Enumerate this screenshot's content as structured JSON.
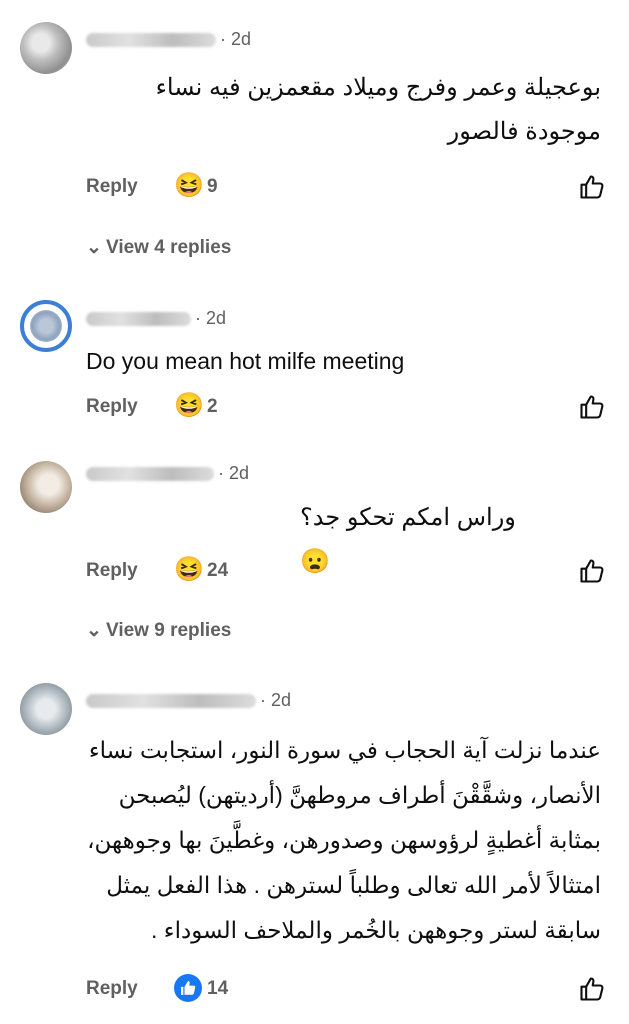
{
  "comments": [
    {
      "time": "· 2d",
      "text": "بوعجيلة وعمر وفرج وميلاد مقعمزين فيه نساء موجودة فالصور",
      "reply_label": "Reply",
      "reaction": "😆",
      "reaction_count": "9",
      "view_replies": "View 4 replies"
    },
    {
      "time": "· 2d",
      "text": "Do you mean hot milfe meeting",
      "reply_label": "Reply",
      "reaction": "😆",
      "reaction_count": "2"
    },
    {
      "time": "· 2d",
      "text": "وراس امكم تحكو جد؟😦",
      "reply_label": "Reply",
      "reaction": "😆",
      "reaction_count": "24",
      "view_replies": "View 9 replies"
    },
    {
      "time": "· 2d",
      "text": "عندما نزلت آية الحجاب في سورة النور، استجابت نساء الأنصار، وشقَّقْنَ أطراف مروطهنَّ (أرديتهن) ليُصبحن بمثابة أغطيةٍ لرؤوسهن وصدورهن، وغطَّينَ بها وجوههن، امتثالاً لأمر الله تعالى وطلباً لسترهن . هذا الفعل يمثل سابقة لستر وجوههن بالخُمر والملاحف السوداء .",
      "reply_label": "Reply",
      "reaction": "👍",
      "reaction_count": "14"
    }
  ]
}
